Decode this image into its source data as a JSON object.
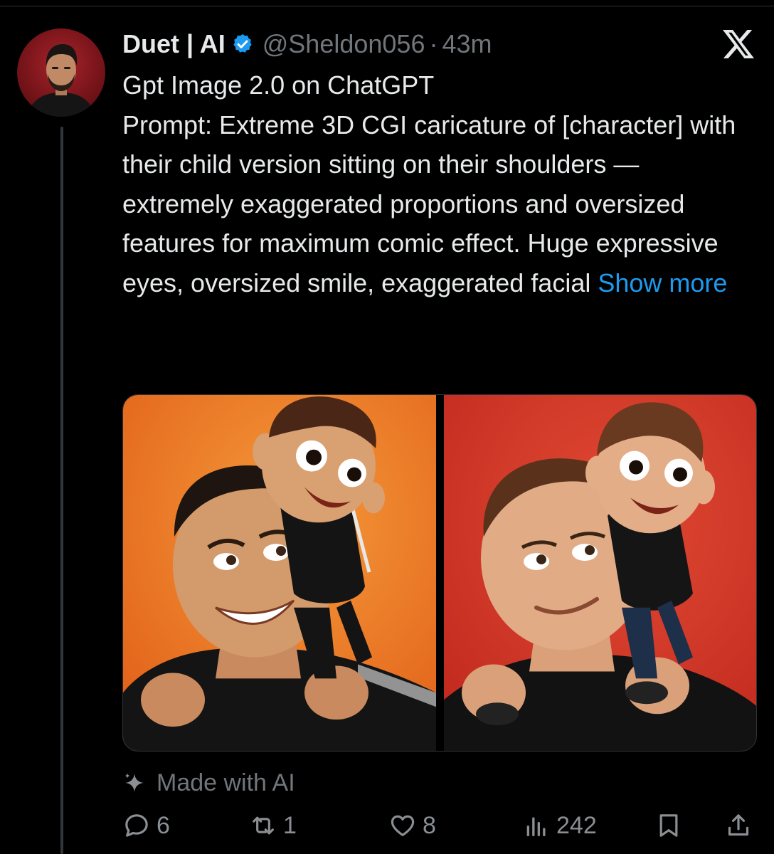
{
  "author": {
    "display_name": "Duet | AI",
    "handle": "@Sheldon056",
    "separator": "·",
    "time": "43m",
    "verified": true
  },
  "tweet": {
    "lines": [
      "Gpt Image 2.0 on ChatGPT",
      "Prompt: Extreme 3D CGI caricature of [character] with their child version sitting on their shoulders — extremely exaggerated proportions and oversized features for maximum comic effect. Huge expressive eyes, oversized smile, exaggerated facial"
    ],
    "show_more": "Show more"
  },
  "media": {
    "images": [
      {
        "background": "#f07a22"
      },
      {
        "background": "#d83a28"
      }
    ]
  },
  "label": {
    "made_with_ai": "Made with AI"
  },
  "actions": {
    "replies": "6",
    "reposts": "1",
    "likes": "8",
    "views": "242"
  },
  "icons": [
    "verified-badge-icon",
    "x-logo-icon",
    "sparkle-icon",
    "reply-icon",
    "repost-icon",
    "like-icon",
    "views-icon",
    "bookmark-icon",
    "share-icon"
  ],
  "colors": {
    "background": "#000000",
    "text": "#e7e9ea",
    "muted": "#71767b",
    "link": "#1d9bf0",
    "verified": "#1d9bf0"
  }
}
